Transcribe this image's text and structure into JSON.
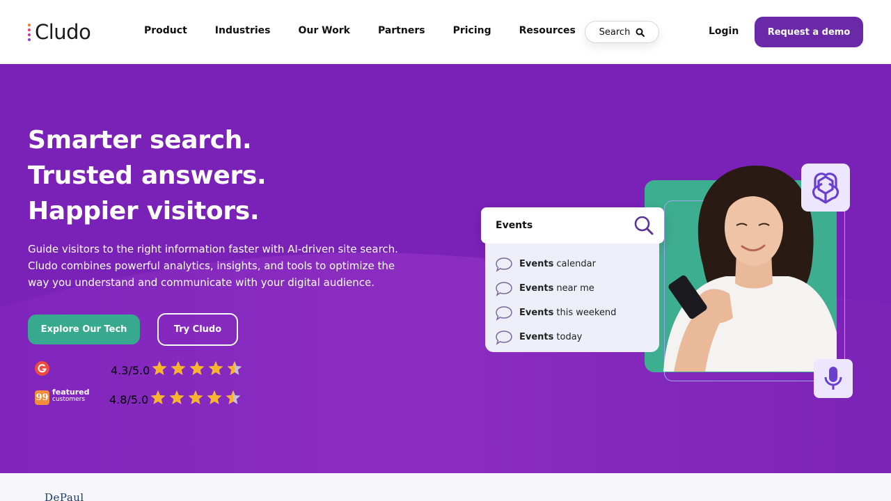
{
  "brand": {
    "name": "Cludo",
    "dot_colors": [
      "#f07c2a",
      "#e63d6e",
      "#8a3fd0"
    ]
  },
  "nav": {
    "items": [
      "Product",
      "Industries",
      "Our Work",
      "Partners",
      "Pricing",
      "Resources"
    ],
    "search_label": "Search",
    "login_label": "Login",
    "demo_label": "Request a demo"
  },
  "hero": {
    "headline": [
      "Smarter search.",
      "Trusted answers.",
      "Happier visitors."
    ],
    "description": "Guide visitors to the right information faster with AI-driven site search. Cludo combines powerful analytics, insights, and tools to optimize the way you understand and communicate with your digital audience.",
    "primary_cta": "Explore Our Tech",
    "secondary_cta": "Try Cludo",
    "ratings": [
      {
        "source_icon": "g2-icon",
        "score": "4.3/5.0",
        "stars": 4.5
      },
      {
        "source_icon": "featured-customers-icon",
        "source_text": [
          "featured",
          "customers"
        ],
        "score": "4.8/5.0",
        "stars": 4.5
      }
    ]
  },
  "demo_search": {
    "query": "Events",
    "suggestions": [
      {
        "bold": "Events",
        "rest": "calendar"
      },
      {
        "bold": "Events",
        "rest": "near me"
      },
      {
        "bold": "Events",
        "rest": "this weekend"
      },
      {
        "bold": "Events",
        "rest": "today"
      }
    ]
  },
  "logos_strip": {
    "first_logo": "DePaul"
  },
  "colors": {
    "hero_bg": "#7a22b7",
    "accent_purple": "#6a2aa7",
    "green": "#37a98e",
    "star": "#f7b42c"
  }
}
